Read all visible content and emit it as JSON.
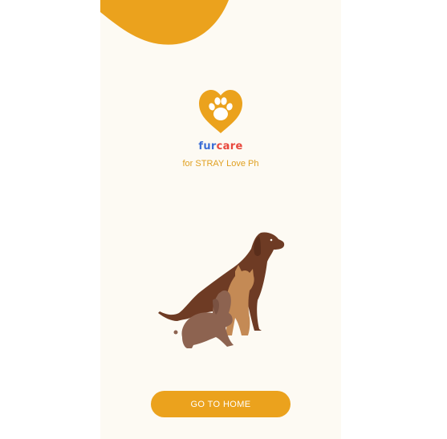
{
  "brand": {
    "name_part1": "fur",
    "name_part2": "care",
    "tagline": "for STRAY Love Ph"
  },
  "actions": {
    "go_home_label": "GO TO HOME"
  },
  "colors": {
    "accent": "#eba21d",
    "background": "#fdfaf3",
    "brand_blue": "#3d6fd6",
    "brand_red": "#e8473c",
    "dog": "#6e3b24",
    "cat": "#c48a55",
    "rabbit": "#8d6350"
  },
  "icons": {
    "logo": "heart-paw-icon",
    "illustration": "dog-cat-rabbit-silhouette"
  }
}
